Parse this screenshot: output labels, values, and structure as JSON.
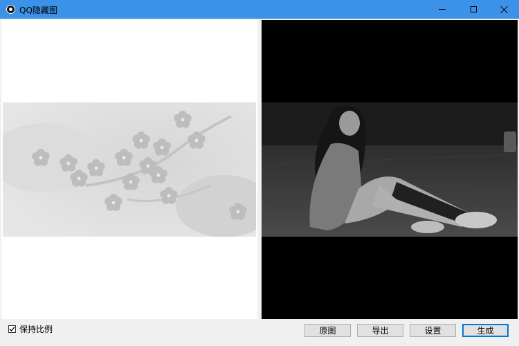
{
  "window": {
    "title": "QQ隐藏图"
  },
  "options": {
    "keep_ratio_label": "保持比例",
    "keep_ratio_checked": true
  },
  "buttons": {
    "original": "原图",
    "export": "导出",
    "settings": "设置",
    "generate": "生成"
  }
}
